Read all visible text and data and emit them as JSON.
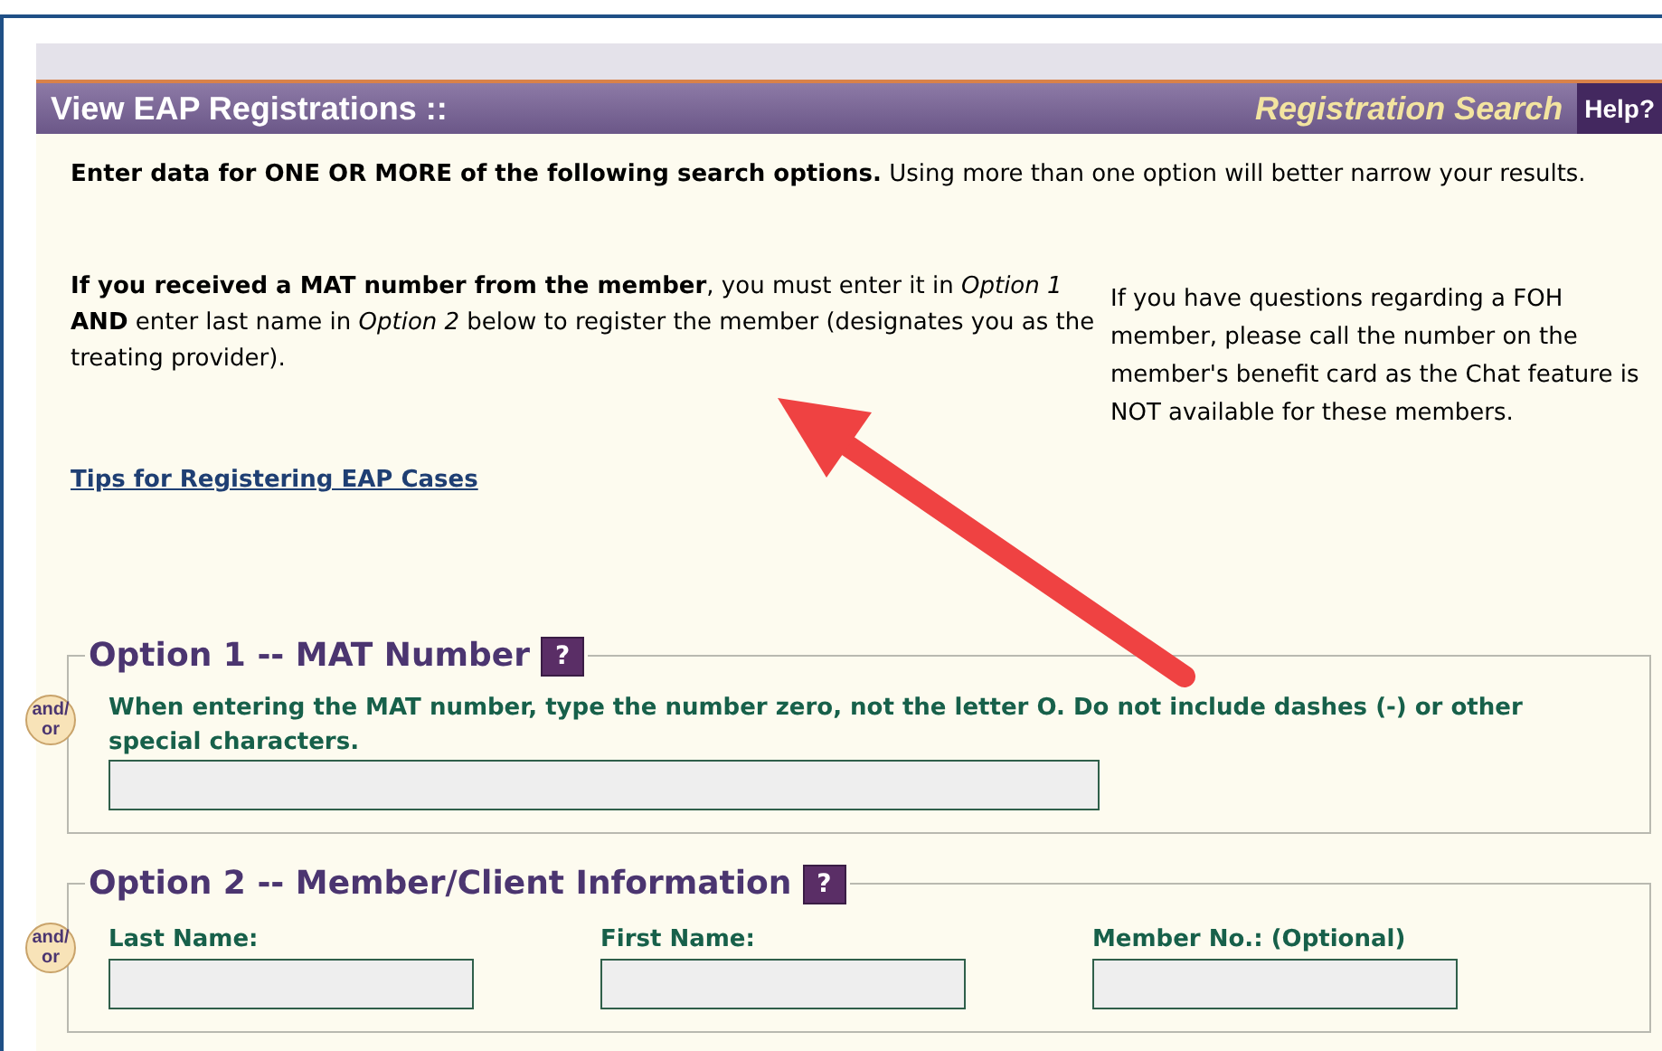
{
  "header": {
    "title": "View EAP Registrations ::",
    "subtitle": "Registration Search",
    "help": "Help?"
  },
  "intro": "**Enter data for ONE OR MORE of the following search options.** Using more than one option will better narrow your results.",
  "mat_note": "**If you received a MAT number from the member**, you must enter it in *Option 1* **AND** enter last name in *Option 2* below to register the member (designates you as the treating provider).",
  "foh_note": "If you have questions regarding a FOH member, please call the number on the member's benefit card as the Chat feature is NOT available for these members.",
  "tips_link": "Tips for Registering EAP Cases",
  "options": [
    {
      "legend": "Option 1 -- MAT Number",
      "help": "?",
      "connector": "and/\nor",
      "hint": "When entering the MAT number, type the number zero, not the letter O. Do not include dashes (-) or other special characters.",
      "fields": [
        {
          "kind": "wide"
        }
      ]
    },
    {
      "legend": "Option 2 -- Member/Client Information",
      "help": "?",
      "connector": "and/\nor",
      "fields": [
        {
          "kind": "labeled",
          "label": "Last Name:"
        },
        {
          "kind": "labeled",
          "label": "First Name:"
        },
        {
          "kind": "labeled",
          "label": "Member No.: (Optional)"
        }
      ]
    }
  ]
}
